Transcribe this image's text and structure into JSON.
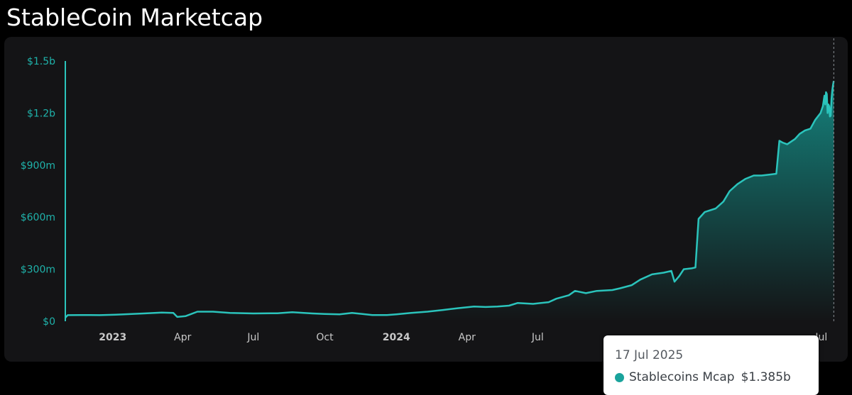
{
  "page": {
    "title": "StableCoin Marketcap"
  },
  "colors": {
    "background": "#000000",
    "panel": "#141416",
    "line": "#2bc4bc",
    "area_top": "#159e96",
    "axis_text": "#1fb2aa",
    "x_label_text": "#c8c8c8",
    "tooltip_dot": "#1aa39c"
  },
  "chart_data": {
    "type": "area",
    "x_type": "date",
    "y_unit": "USD",
    "y_ticks": [
      {
        "value": 0,
        "label": "$0"
      },
      {
        "value": 300000000,
        "label": "$300m"
      },
      {
        "value": 600000000,
        "label": "$600m"
      },
      {
        "value": 900000000,
        "label": "$900m"
      },
      {
        "value": 1200000000,
        "label": "$1.2b"
      },
      {
        "value": 1500000000,
        "label": "$1.5b"
      }
    ],
    "ylim": [
      0,
      1500000000
    ],
    "xlim": [
      "2022-11-01",
      "2025-07-24"
    ],
    "x_ticks": [
      {
        "date": "2023-01-01",
        "label": "2023",
        "bold": true
      },
      {
        "date": "2023-04-01",
        "label": "Apr",
        "bold": false
      },
      {
        "date": "2023-07-01",
        "label": "Jul",
        "bold": false
      },
      {
        "date": "2023-10-01",
        "label": "Oct",
        "bold": false
      },
      {
        "date": "2024-01-01",
        "label": "2024",
        "bold": true
      },
      {
        "date": "2024-04-01",
        "label": "Apr",
        "bold": false
      },
      {
        "date": "2024-07-01",
        "label": "Jul",
        "bold": false
      },
      {
        "date": "2025-07-01",
        "label": "Jul",
        "bold": false
      }
    ],
    "grid": false,
    "series": [
      {
        "values": [
          [
            "2022-11-01",
            20000000
          ],
          [
            "2022-11-04",
            35000000
          ],
          [
            "2022-11-20",
            36000000
          ],
          [
            "2022-12-15",
            35000000
          ],
          [
            "2023-01-05",
            38000000
          ],
          [
            "2023-02-10",
            45000000
          ],
          [
            "2023-03-05",
            50000000
          ],
          [
            "2023-03-20",
            48000000
          ],
          [
            "2023-03-25",
            25000000
          ],
          [
            "2023-04-05",
            30000000
          ],
          [
            "2023-04-20",
            55000000
          ],
          [
            "2023-05-10",
            55000000
          ],
          [
            "2023-06-01",
            48000000
          ],
          [
            "2023-07-01",
            45000000
          ],
          [
            "2023-08-01",
            46000000
          ],
          [
            "2023-08-20",
            52000000
          ],
          [
            "2023-09-15",
            45000000
          ],
          [
            "2023-10-01",
            42000000
          ],
          [
            "2023-10-20",
            40000000
          ],
          [
            "2023-11-05",
            48000000
          ],
          [
            "2023-12-01",
            36000000
          ],
          [
            "2023-12-20",
            36000000
          ],
          [
            "2024-01-01",
            40000000
          ],
          [
            "2024-01-20",
            48000000
          ],
          [
            "2024-02-10",
            55000000
          ],
          [
            "2024-03-01",
            65000000
          ],
          [
            "2024-03-20",
            75000000
          ],
          [
            "2024-04-10",
            85000000
          ],
          [
            "2024-04-25",
            82000000
          ],
          [
            "2024-05-10",
            85000000
          ],
          [
            "2024-05-25",
            90000000
          ],
          [
            "2024-06-05",
            105000000
          ],
          [
            "2024-06-25",
            100000000
          ],
          [
            "2024-07-15",
            110000000
          ],
          [
            "2024-07-25",
            130000000
          ],
          [
            "2024-08-10",
            150000000
          ],
          [
            "2024-08-18",
            175000000
          ],
          [
            "2024-09-01",
            162000000
          ],
          [
            "2024-09-15",
            175000000
          ],
          [
            "2024-10-05",
            180000000
          ],
          [
            "2024-10-15",
            190000000
          ],
          [
            "2024-10-30",
            208000000
          ],
          [
            "2024-11-10",
            240000000
          ],
          [
            "2024-11-25",
            270000000
          ],
          [
            "2024-12-10",
            280000000
          ],
          [
            "2024-12-20",
            290000000
          ],
          [
            "2024-12-24",
            228000000
          ],
          [
            "2024-12-30",
            260000000
          ],
          [
            "2025-01-05",
            300000000
          ],
          [
            "2025-01-15",
            305000000
          ],
          [
            "2025-01-20",
            310000000
          ],
          [
            "2025-01-24",
            590000000
          ],
          [
            "2025-02-01",
            630000000
          ],
          [
            "2025-02-15",
            650000000
          ],
          [
            "2025-02-25",
            690000000
          ],
          [
            "2025-03-05",
            750000000
          ],
          [
            "2025-03-15",
            790000000
          ],
          [
            "2025-03-25",
            820000000
          ],
          [
            "2025-04-05",
            840000000
          ],
          [
            "2025-04-15",
            840000000
          ],
          [
            "2025-04-25",
            845000000
          ],
          [
            "2025-05-04",
            850000000
          ],
          [
            "2025-05-08",
            1040000000
          ],
          [
            "2025-05-12",
            1030000000
          ],
          [
            "2025-05-18",
            1020000000
          ],
          [
            "2025-05-28",
            1050000000
          ],
          [
            "2025-06-03",
            1080000000
          ],
          [
            "2025-06-10",
            1100000000
          ],
          [
            "2025-06-17",
            1110000000
          ],
          [
            "2025-06-23",
            1160000000
          ],
          [
            "2025-06-30",
            1200000000
          ],
          [
            "2025-07-03",
            1240000000
          ],
          [
            "2025-07-05",
            1300000000
          ],
          [
            "2025-07-06",
            1250000000
          ],
          [
            "2025-07-07",
            1320000000
          ],
          [
            "2025-07-08",
            1310000000
          ],
          [
            "2025-07-09",
            1200000000
          ],
          [
            "2025-07-10",
            1250000000
          ],
          [
            "2025-07-11",
            1240000000
          ],
          [
            "2025-07-12",
            1180000000
          ],
          [
            "2025-07-13",
            1185000000
          ],
          [
            "2025-07-14",
            1280000000
          ],
          [
            "2025-07-15",
            1330000000
          ],
          [
            "2025-07-16",
            1360000000
          ],
          [
            "2025-07-17",
            1385000000
          ]
        ]
      }
    ],
    "crosshair_date": "2025-07-17",
    "tooltip": {
      "date": "17 Jul 2025",
      "series_label": "Stablecoins Mcap",
      "value_label": "$1.385b"
    }
  }
}
